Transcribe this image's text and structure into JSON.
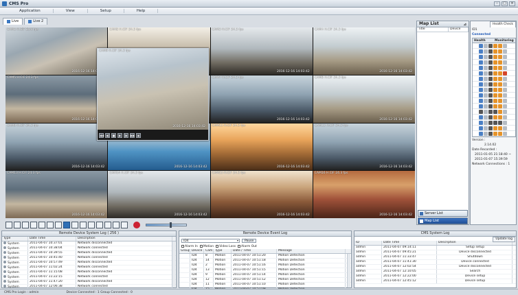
{
  "window": {
    "title": "CMS Pro"
  },
  "menu": [
    "Application",
    "View",
    "Setup",
    "Help"
  ],
  "tabs": [
    {
      "label": "Live",
      "active": true
    },
    {
      "label": "Live 2",
      "active": false
    }
  ],
  "cameras": [
    {
      "label": "CAM1 H.CIF 25.0 fps",
      "time": "2016-12-16 14:03:42"
    },
    {
      "label": "CAM2 H.CIF 24.3 fps",
      "time": "2016-12-16 14:03:42"
    },
    {
      "label": "CAM3 H.CIF 24.3 fps",
      "time": "2016-12-16 14:03:42"
    },
    {
      "label": "CAM4 H.CIF 24.3 fps",
      "time": "2016-12-16 14:03:42"
    },
    {
      "label": "CAM5 H.CIF 24.3 fps",
      "time": "2016-12-16 14:03:42"
    },
    {
      "label": "CAM6 H.CIF 24.3 fps",
      "time": "2016-12-16 14:03:42"
    },
    {
      "label": "CAM7 H.CIF 24.3 fps",
      "time": "2016-12-16 14:03:42"
    },
    {
      "label": "CAM8 H.CIF 24.3 fps",
      "time": "2016-12-16 14:03:42"
    },
    {
      "label": "CAM9 H.CIF 24.3 fps",
      "time": "2016-12-16 14:03:42"
    },
    {
      "label": "CAM10 H.CIF 24.3 fps",
      "time": "2016-12-16 14:03:42"
    },
    {
      "label": "CAM11 H.CIF 24.3 fps",
      "time": "2016-12-16 14:03:42"
    },
    {
      "label": "CAM12 H.CIF 24.3 fps",
      "time": "2016-12-16 14:03:42"
    },
    {
      "label": "CAM13 H.CIF 24.3 fps",
      "time": "2016-12-16 14:03:42"
    },
    {
      "label": "CAM14 H.CIF 24.3 fps",
      "time": "2016-12-16 14:03:42"
    },
    {
      "label": "CAM15 H.CIF 24.3 fps",
      "time": "2016-12-16 14:03:42"
    },
    {
      "label": "CAM16 H.CIF 24.3 fps",
      "time": "2016-12-16 14:03:42"
    }
  ],
  "popup": {
    "label": "CAM9 H.CIF 24.3 fps",
    "time": "2016-12-16 14:03:42"
  },
  "map_list": {
    "title": "Map List",
    "columns": [
      "Title",
      "Device"
    ],
    "buttons": [
      "Server List",
      "Map List"
    ]
  },
  "health": {
    "tab": "Health Check",
    "device": "ID1",
    "status": "Connected",
    "columns": [
      "Health",
      "Monitoring"
    ],
    "version_label": "Version :",
    "version": "2.14.02",
    "date_label": "Date Recorded :",
    "date_from": "2011-01-05 21:18:40 ~",
    "date_to": "2011-01-07 15:39:59",
    "net_label": "Network Connections :",
    "net_value": "1"
  },
  "system_log": {
    "title": "Remote Device System Log ( 256 )",
    "columns": [
      "Type",
      "Date Time",
      "Description"
    ],
    "rows": [
      {
        "type": "System",
        "date": "2011-04-07 10:37:01",
        "desc": "Network disconnected"
      },
      {
        "type": "System",
        "date": "2011-04-07 10:38:04",
        "desc": "Network connected"
      },
      {
        "type": "System",
        "date": "2011-04-07 10:39:55",
        "desc": "Network disconnected"
      },
      {
        "type": "System",
        "date": "2011-04-07 10:45:40",
        "desc": "Network connected"
      },
      {
        "type": "System",
        "date": "2011-04-07 10:57:49",
        "desc": "Network disconnected"
      },
      {
        "type": "System",
        "date": "2011-04-07 11:02:24",
        "desc": "Network connected"
      },
      {
        "type": "System",
        "date": "2011-04-07 11:15:08",
        "desc": "Network disconnected"
      },
      {
        "type": "System",
        "date": "2011-04-07 11:22:15",
        "desc": "Network connected"
      },
      {
        "type": "System",
        "date": "2011-04-07 11:47:20",
        "desc": "Network disconnected"
      },
      {
        "type": "System",
        "date": "2011-04-07 12:06:38",
        "desc": "Network connected"
      }
    ]
  },
  "event_log": {
    "title": "Remote Device Event Log",
    "select_value": "ID4",
    "pause_label": "Pause",
    "filters": [
      "Alarm In",
      "Motion",
      "Video Loss",
      "Alarm Out"
    ],
    "columns": [
      "Group",
      "Device",
      "Cam",
      "Type",
      "Date / Time",
      "Message"
    ],
    "rows": [
      {
        "group": "",
        "device": "ID4",
        "cam": "8",
        "type": "Motion",
        "date": "2011-04-07 10:51:20",
        "msg": "Motion Detection"
      },
      {
        "group": "",
        "device": "ID4",
        "cam": "14",
        "type": "Motion",
        "date": "2011-04-07 10:51:18",
        "msg": "Motion Detection"
      },
      {
        "group": "",
        "device": "ID4",
        "cam": "2",
        "type": "Motion",
        "date": "2011-04-07 10:51:16",
        "msg": "Motion Detection"
      },
      {
        "group": "",
        "device": "ID4",
        "cam": "13",
        "type": "Motion",
        "date": "2011-04-07 10:51:15",
        "msg": "Motion Detection"
      },
      {
        "group": "",
        "device": "ID4",
        "cam": "9",
        "type": "Motion",
        "date": "2011-04-07 10:51:14",
        "msg": "Motion Detection"
      },
      {
        "group": "",
        "device": "ID4",
        "cam": "12",
        "type": "Motion",
        "date": "2011-04-07 10:51:12",
        "msg": "Motion Detection"
      },
      {
        "group": "",
        "device": "ID4",
        "cam": "11",
        "type": "Motion",
        "date": "2011-04-07 10:51:10",
        "msg": "Motion Detection"
      },
      {
        "group": "",
        "device": "ID4",
        "cam": "15",
        "type": "Motion",
        "date": "2011-04-07 10:51:08",
        "msg": "Motion Detection"
      }
    ]
  },
  "cms_log": {
    "title": "CMS System Log",
    "update_tab": "Update log",
    "columns": [
      "ID",
      "Date Time",
      "Description"
    ],
    "rows": [
      {
        "id": "admin",
        "date": "2011-04-07 09:14:11",
        "desc": "Setup setup"
      },
      {
        "id": "admin",
        "date": "2011-04-07 09:45:21",
        "desc": "Device disconnected"
      },
      {
        "id": "admin",
        "date": "2011-04-07 11:33:47",
        "desc": "Shutdown"
      },
      {
        "id": "admin",
        "date": "2011-04-07 11:41:30",
        "desc": "Device connected"
      },
      {
        "id": "admin",
        "date": "2011-04-07 12:02:54",
        "desc": "Device disconnected"
      },
      {
        "id": "admin",
        "date": "2011-04-07 12:10:05",
        "desc": "Search"
      },
      {
        "id": "admin",
        "date": "2011-04-07 12:22:00",
        "desc": "Device setup"
      },
      {
        "id": "admin",
        "date": "2011-04-07 12:45:12",
        "desc": "Device setup"
      }
    ]
  },
  "status": {
    "login": "CMS Pro Login : admin",
    "devices": "Device Connected : 1   Group Connected : 0"
  }
}
